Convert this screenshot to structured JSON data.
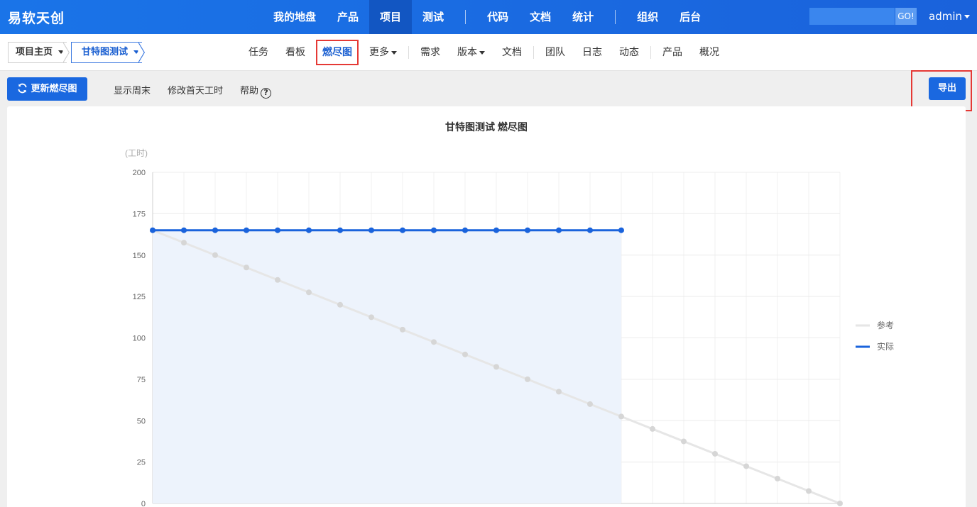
{
  "topnav": {
    "brand": "易软天创",
    "items": [
      {
        "label": "我的地盘",
        "active": false
      },
      {
        "label": "产品",
        "active": false
      },
      {
        "label": "项目",
        "active": true
      },
      {
        "label": "测试",
        "active": false
      },
      {
        "label": "代码",
        "active": false
      },
      {
        "label": "文档",
        "active": false
      },
      {
        "label": "统计",
        "active": false
      },
      {
        "label": "组织",
        "active": false
      },
      {
        "label": "后台",
        "active": false
      }
    ],
    "search_value": "",
    "go_label": "GO!",
    "user": "admin"
  },
  "breadcrumb": {
    "home": "项目主页",
    "current": "甘特图测试"
  },
  "subnav": {
    "items": [
      {
        "label": "任务",
        "active": false,
        "dropdown": false
      },
      {
        "label": "看板",
        "active": false,
        "dropdown": false
      },
      {
        "label": "燃尽图",
        "active": true,
        "dropdown": false
      },
      {
        "label": "更多",
        "active": false,
        "dropdown": true
      },
      {
        "label": "需求",
        "active": false,
        "dropdown": false
      },
      {
        "label": "版本",
        "active": false,
        "dropdown": true
      },
      {
        "label": "文档",
        "active": false,
        "dropdown": false
      },
      {
        "label": "团队",
        "active": false,
        "dropdown": false
      },
      {
        "label": "日志",
        "active": false,
        "dropdown": false
      },
      {
        "label": "动态",
        "active": false,
        "dropdown": false
      },
      {
        "label": "产品",
        "active": false,
        "dropdown": false
      },
      {
        "label": "概况",
        "active": false,
        "dropdown": false
      }
    ]
  },
  "toolbar": {
    "refresh_label": "更新燃尽图",
    "show_weekend": "显示周末",
    "modify_first_day": "修改首天工时",
    "help": "帮助",
    "help_icon": "?",
    "export_label": "导出"
  },
  "colors": {
    "brand": "#1a6ae6",
    "actual": "#1a63dc",
    "reference": "#e6e6e6",
    "reference_point": "#d6d6d6",
    "area": "#edf3fc",
    "highlight": "#e53935"
  },
  "chart_data": {
    "type": "line",
    "title": "甘特图测试 燃尽图",
    "ylabel": "(工时)",
    "xlabel": "",
    "ylim": [
      0,
      200
    ],
    "yticks": [
      0,
      25,
      50,
      75,
      100,
      125,
      150,
      175,
      200
    ],
    "x_count": 23,
    "grid": true,
    "legend_position": "right",
    "series": [
      {
        "name": "参考",
        "values": [
          165,
          157.5,
          150,
          142.5,
          135,
          127.5,
          120,
          112.5,
          105,
          97.5,
          90,
          82.5,
          75,
          67.5,
          60,
          52.5,
          45,
          37.5,
          30,
          22.5,
          15,
          7.5,
          0
        ]
      },
      {
        "name": "实际",
        "values": [
          165,
          165,
          165,
          165,
          165,
          165,
          165,
          165,
          165,
          165,
          165,
          165,
          165,
          165,
          165,
          165
        ],
        "area": true
      }
    ]
  }
}
